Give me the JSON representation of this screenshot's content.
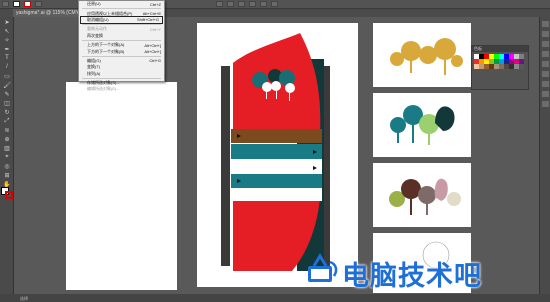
{
  "app": {
    "doc_tab": "yashigma*.ai @ 115% (CMYK/...",
    "status": "选择"
  },
  "menu": {
    "items": [
      {
        "label": "还原(U)",
        "shortcut": "Ctrl+Z",
        "enabled": true,
        "highlighted": false
      },
      {
        "label": "应用透视以上未描组合(P)",
        "shortcut": "Alt+Ctrl+E",
        "enabled": true,
        "highlighted": false
      },
      {
        "label": "取消编组(U)",
        "shortcut": "Shift+Ctrl+G",
        "enabled": true,
        "highlighted": true
      },
      {
        "label": "重做无动作",
        "shortcut": "Ctrl+Y",
        "enabled": false,
        "highlighted": false
      },
      {
        "label": "再次变换",
        "shortcut": "",
        "enabled": true,
        "highlighted": false
      },
      {
        "label": "上方的下一个对象(A)",
        "shortcut": "Alt+Ctrl+]",
        "enabled": true,
        "highlighted": false
      },
      {
        "label": "下方的下一个对象(B)",
        "shortcut": "Alt+Ctrl+[",
        "enabled": true,
        "highlighted": false
      },
      {
        "label": "编组(G)",
        "shortcut": "Ctrl+G",
        "enabled": true,
        "highlighted": false
      },
      {
        "label": "变换(T)",
        "shortcut": "",
        "enabled": true,
        "highlighted": false
      },
      {
        "label": "排列(A)",
        "shortcut": "",
        "enabled": true,
        "highlighted": false
      },
      {
        "label": "存储所选对象(S)...",
        "shortcut": "",
        "enabled": true,
        "highlighted": false
      },
      {
        "label": "编辑所选对象(E)...",
        "shortcut": "",
        "enabled": false,
        "highlighted": false
      }
    ]
  },
  "swatches_panel": {
    "title": "色板",
    "colors": [
      "#ffffff",
      "#000000",
      "#ff0000",
      "#ffff00",
      "#00ff00",
      "#00ffff",
      "#0000ff",
      "#ff00ff",
      "#c8c8c8",
      "#7f7f7f",
      "#e6332a",
      "#f39800",
      "#fff100",
      "#8fc31f",
      "#009944",
      "#00a0e9",
      "#1d2088",
      "#920783",
      "#e4007f",
      "#601986",
      "#f7c5a0",
      "#c39b6a",
      "#956134",
      "#6a3906",
      "#a6937c",
      "#7c6f5e",
      "#534741",
      "#362e2b",
      "#898989",
      "#595757"
    ]
  },
  "watermark": {
    "text": "电脑技术吧"
  },
  "colors": {
    "red": "#e41e24",
    "teal": "#197b86",
    "dark_teal": "#12383a",
    "brown": "#7b4a1f",
    "pole": "#3a3a3a"
  }
}
